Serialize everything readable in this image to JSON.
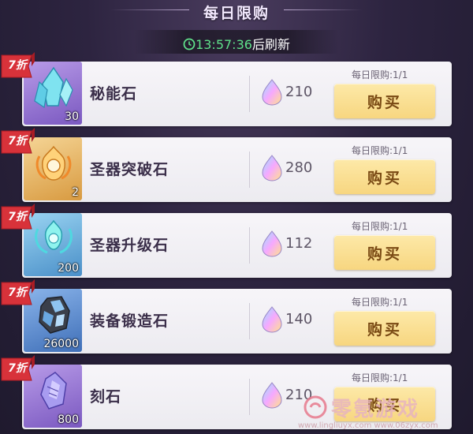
{
  "header": {
    "title": "每日限购",
    "countdown_time": "13:57:36",
    "countdown_suffix": "后刷新"
  },
  "currency_icon": "rainbow-gem-icon",
  "items": [
    {
      "discount": "7折",
      "name": "秘能石",
      "quantity": "30",
      "price": "210",
      "limit": "每日限购:1/1",
      "buy_label": "购买",
      "icon": "blue-crystal-icon",
      "tile_color": "#8e6fd0"
    },
    {
      "discount": "7折",
      "name": "圣器突破石",
      "quantity": "2",
      "price": "280",
      "limit": "每日限购:1/1",
      "buy_label": "购买",
      "icon": "flame-emblem-icon",
      "tile_color": "#e6b35a"
    },
    {
      "discount": "7折",
      "name": "圣器升级石",
      "quantity": "200",
      "price": "112",
      "limit": "每日限购:1/1",
      "buy_label": "购买",
      "icon": "aqua-emblem-icon",
      "tile_color": "#5aa6d6"
    },
    {
      "discount": "7折",
      "name": "装备锻造石",
      "quantity": "26000",
      "price": "140",
      "limit": "每日限购:1/1",
      "buy_label": "购买",
      "icon": "ore-stone-icon",
      "tile_color": "#4f7fc7"
    },
    {
      "discount": "7折",
      "name": "刻石",
      "quantity": "800",
      "price": "210",
      "limit": "每日限购:1/1",
      "buy_label": "购买",
      "icon": "purple-crystal-icon",
      "tile_color": "#8e6fd0"
    }
  ],
  "watermark": {
    "text": "零氪游戏",
    "url": "www.lingliuyx.com  www.06zyx.com"
  }
}
